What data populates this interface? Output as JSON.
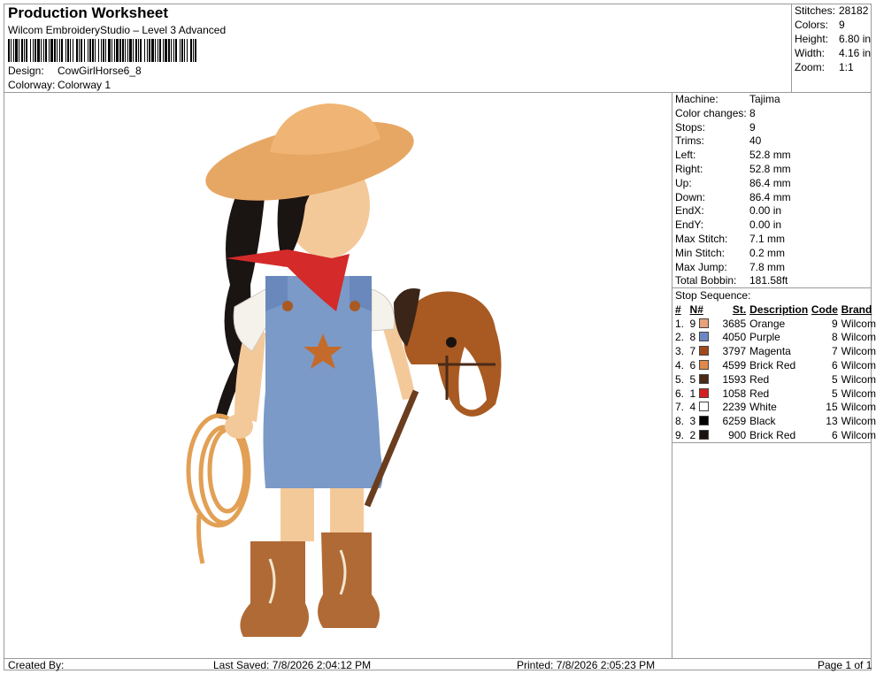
{
  "header": {
    "title": "Production Worksheet",
    "subtitle": "Wilcom EmbroideryStudio – Level 3 Advanced",
    "design_label": "Design:",
    "design_value": "CowGirlHorse6_8",
    "colorway_label": "Colorway:",
    "colorway_value": "Colorway 1"
  },
  "stats": [
    {
      "label": "Stitches:",
      "value": "28182"
    },
    {
      "label": "Colors:",
      "value": "9"
    },
    {
      "label": "Height:",
      "value": "6.80 in"
    },
    {
      "label": "Width:",
      "value": "4.16 in"
    },
    {
      "label": "Zoom:",
      "value": "1:1"
    }
  ],
  "machine_info": [
    {
      "label": "Machine:",
      "value": "Tajima"
    },
    {
      "label": "Color changes:",
      "value": "8"
    },
    {
      "label": "Stops:",
      "value": "9"
    },
    {
      "label": "Trims:",
      "value": "40"
    },
    {
      "label": "Left:",
      "value": "52.8 mm"
    },
    {
      "label": "Right:",
      "value": "52.8 mm"
    },
    {
      "label": "Up:",
      "value": "86.4 mm"
    },
    {
      "label": "Down:",
      "value": "86.4 mm"
    },
    {
      "label": "EndX:",
      "value": "0.00 in"
    },
    {
      "label": "EndY:",
      "value": "0.00 in"
    },
    {
      "label": "Max Stitch:",
      "value": "7.1 mm"
    },
    {
      "label": "Min Stitch:",
      "value": "0.2 mm"
    },
    {
      "label": "Max Jump:",
      "value": "7.8 mm"
    },
    {
      "label": "Total Bobbin:",
      "value": "181.58ft"
    }
  ],
  "stop_sequence": {
    "title": "Stop Sequence:",
    "headers": {
      "num": "#",
      "n": "N#",
      "st": "St.",
      "desc": "Description",
      "code": "Code",
      "brand": "Brand"
    },
    "rows": [
      {
        "num": "1.",
        "n": "9",
        "color": "#e8a27c",
        "st": "3685",
        "desc": "Orange",
        "code": "9",
        "brand": "Wilcom"
      },
      {
        "num": "2.",
        "n": "8",
        "color": "#6a88c4",
        "st": "4050",
        "desc": "Purple",
        "code": "8",
        "brand": "Wilcom"
      },
      {
        "num": "3.",
        "n": "7",
        "color": "#a04a1c",
        "st": "3797",
        "desc": "Magenta",
        "code": "7",
        "brand": "Wilcom"
      },
      {
        "num": "4.",
        "n": "6",
        "color": "#e0894a",
        "st": "4599",
        "desc": "Brick Red",
        "code": "6",
        "brand": "Wilcom"
      },
      {
        "num": "5.",
        "n": "5",
        "color": "#4a2a18",
        "st": "1593",
        "desc": "Red",
        "code": "5",
        "brand": "Wilcom"
      },
      {
        "num": "6.",
        "n": "1",
        "color": "#d42020",
        "st": "1058",
        "desc": "Red",
        "code": "5",
        "brand": "Wilcom"
      },
      {
        "num": "7.",
        "n": "4",
        "color": "#ffffff",
        "st": "2239",
        "desc": "White",
        "code": "15",
        "brand": "Wilcom"
      },
      {
        "num": "8.",
        "n": "3",
        "color": "#000000",
        "st": "6259",
        "desc": "Black",
        "code": "13",
        "brand": "Wilcom"
      },
      {
        "num": "9.",
        "n": "2",
        "color": "#1a1210",
        "st": "900",
        "desc": "Brick Red",
        "code": "6",
        "brand": "Wilcom"
      }
    ]
  },
  "footer": {
    "created_by": "Created By:",
    "last_saved": "Last Saved: 7/8/2026 2:04:12 PM",
    "printed": "Printed: 7/8/2026 2:05:23 PM",
    "page": "Page 1 of 1"
  }
}
